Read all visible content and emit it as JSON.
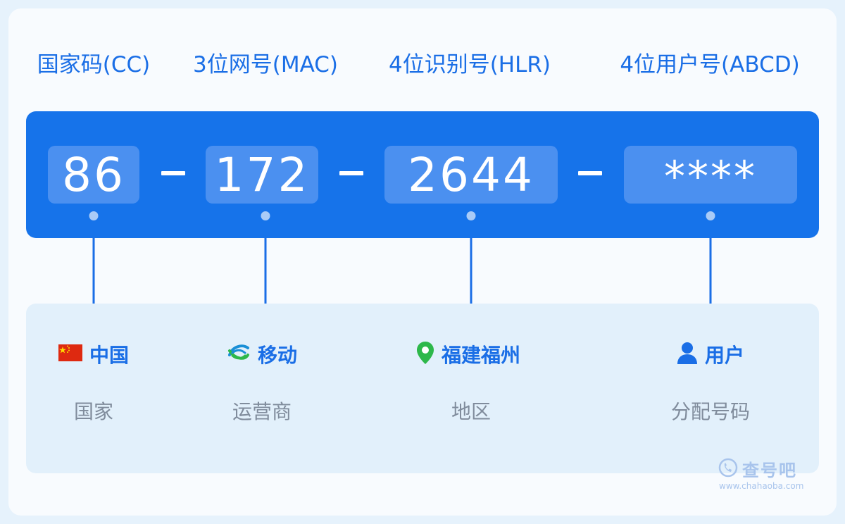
{
  "headers": [
    "国家码(CC)",
    "3位网号(MAC)",
    "4位识别号(HLR)",
    "4位用户号(ABCD)"
  ],
  "segments": [
    "86",
    "172",
    "2644",
    "****"
  ],
  "labels": [
    {
      "text": "中国",
      "icon": "china-flag-icon"
    },
    {
      "text": "移动",
      "icon": "china-mobile-logo-icon"
    },
    {
      "text": "福建福州",
      "icon": "location-pin-icon"
    },
    {
      "text": "用户",
      "icon": "user-icon"
    }
  ],
  "sublabels": [
    "国家",
    "运营商",
    "地区",
    "分配号码"
  ],
  "watermark": {
    "name": "查号吧",
    "url": "www.chahaoba.com"
  },
  "colors": {
    "accent": "#1673ea",
    "segment_bg": "#4b90f0",
    "info_bg": "#e2f0fb",
    "sub_text": "#808c9c",
    "pin": "#2db84a",
    "flag": "#de2910"
  }
}
